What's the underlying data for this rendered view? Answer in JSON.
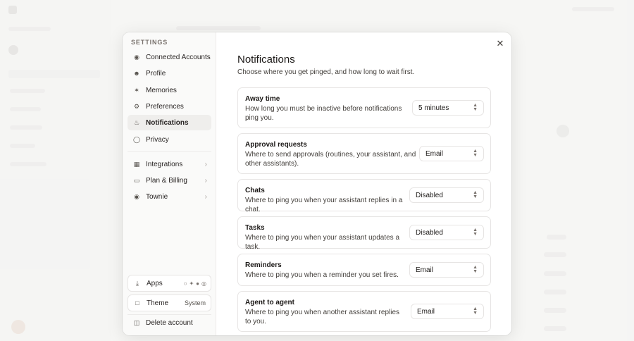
{
  "nav": {
    "heading": "SETTINGS",
    "items": [
      {
        "label": "Connected Accounts",
        "icon": "globe-icon"
      },
      {
        "label": "Profile",
        "icon": "user-icon"
      },
      {
        "label": "Memories",
        "icon": "sparkle-icon"
      },
      {
        "label": "Preferences",
        "icon": "gear-icon"
      },
      {
        "label": "Notifications",
        "icon": "bell-icon",
        "active": true
      },
      {
        "label": "Privacy",
        "icon": "shield-icon"
      }
    ],
    "sub_items": [
      {
        "label": "Integrations",
        "icon": "grid-icon"
      },
      {
        "label": "Plan & Billing",
        "icon": "card-icon"
      },
      {
        "label": "Townie",
        "icon": "townie-icon"
      }
    ],
    "apps_label": "Apps",
    "theme_label": "Theme",
    "theme_value": "System",
    "delete_label": "Delete account"
  },
  "content": {
    "title": "Notifications",
    "subtitle": "Choose where you get pinged, and how long to wait first.",
    "rows": [
      {
        "title": "Away time",
        "desc": "How long you must be inactive before notifications ping you.",
        "value": "5 minutes"
      },
      {
        "title": "Approval requests",
        "desc": "Where to send approvals (routines, your assistant, and other assistants).",
        "value": "Email"
      },
      {
        "title": "Chats",
        "desc": "Where to ping you when your assistant replies in a chat.",
        "value": "Disabled"
      },
      {
        "title": "Tasks",
        "desc": "Where to ping you when your assistant updates a task.",
        "value": "Disabled"
      },
      {
        "title": "Reminders",
        "desc": "Where to ping you when a reminder you set fires.",
        "value": "Email"
      },
      {
        "title": "Agent to agent",
        "desc": "Where to ping you when another assistant replies to you.",
        "value": "Email"
      }
    ]
  }
}
